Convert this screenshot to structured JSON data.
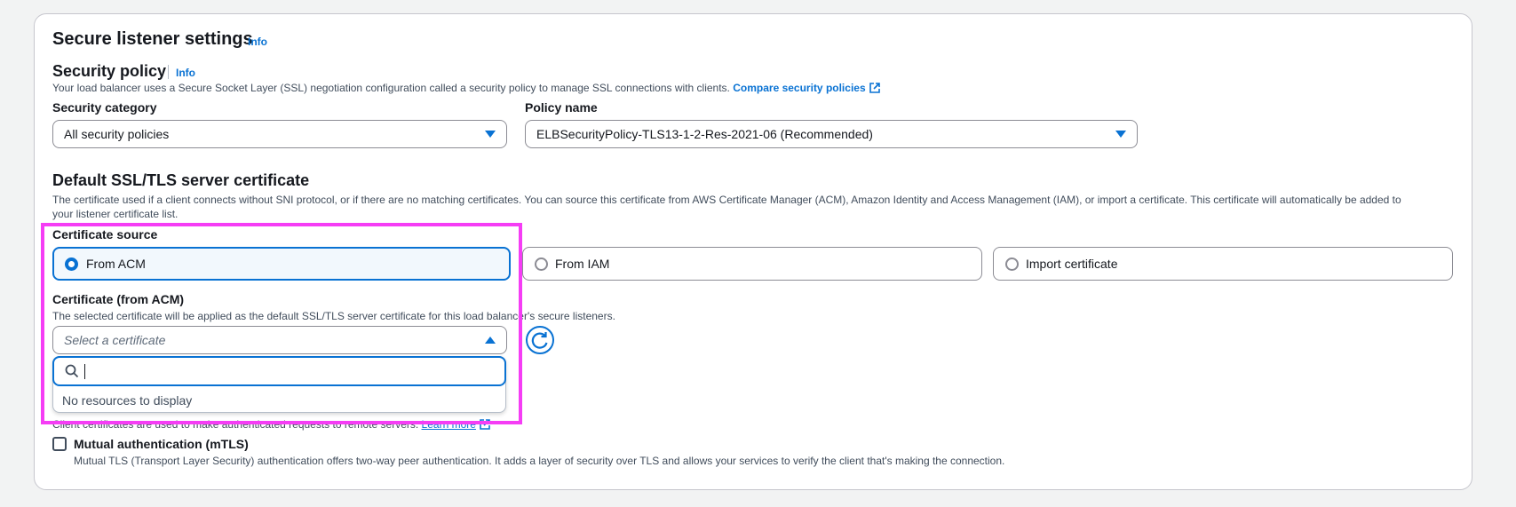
{
  "section": {
    "title": "Secure listener settings",
    "info": "Info"
  },
  "security_policy": {
    "title": "Security policy",
    "info": "Info",
    "description": "Your load balancer uses a Secure Socket Layer (SSL) negotiation configuration called a security policy to manage SSL connections with clients.",
    "compare_link": "Compare security policies",
    "category_label": "Security category",
    "category_value": "All security policies",
    "policy_label": "Policy name",
    "policy_value": "ELBSecurityPolicy-TLS13-1-2-Res-2021-06 (Recommended)"
  },
  "certificate": {
    "title": "Default SSL/TLS server certificate",
    "description_line1": "The certificate used if a client connects without SNI protocol, or if there are no matching certificates. You can source this certificate from AWS Certificate Manager (ACM), Amazon Identity and Access Management (IAM), or import a certificate. This certificate will automatically be added to",
    "description_line2": "your listener certificate list.",
    "source_label": "Certificate source",
    "sources": [
      {
        "label": "From ACM",
        "selected": true
      },
      {
        "label": "From IAM",
        "selected": false
      },
      {
        "label": "Import certificate",
        "selected": false
      }
    ],
    "acm_label": "Certificate (from ACM)",
    "acm_description": "The selected certificate will be applied as the default SSL/TLS server certificate for this load balancer's secure listeners.",
    "select_placeholder": "Select a certificate",
    "search_value": "",
    "empty_text": "No resources to display"
  },
  "client_cert": {
    "description": "Client certificates are used to make authenticated requests to remote servers.",
    "learn_more": "Learn more",
    "mtls_label": "Mutual authentication (mTLS)",
    "mtls_description": "Mutual TLS (Transport Layer Security) authentication offers two-way peer authentication. It adds a layer of security over TLS and allows your services to verify the client that's making the connection."
  },
  "colors": {
    "accent": "#0972d3",
    "highlight": "#f53df5"
  }
}
